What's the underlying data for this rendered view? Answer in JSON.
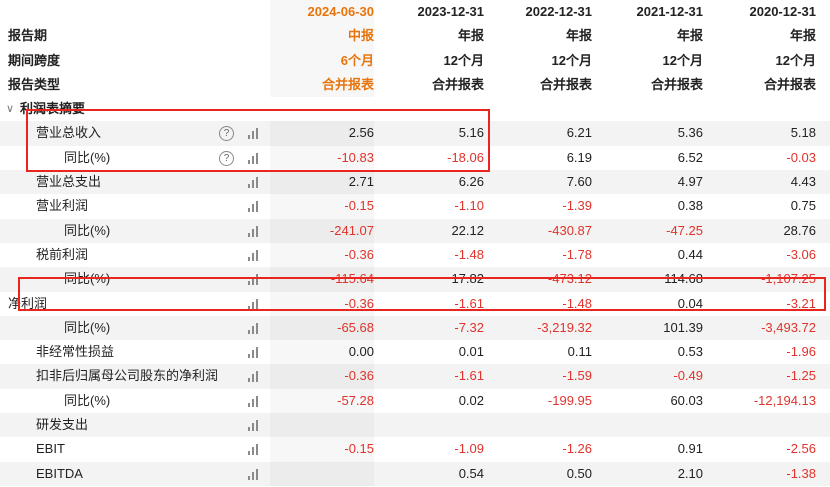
{
  "header": {
    "periods": [
      "2024-06-30",
      "2023-12-31",
      "2022-12-31",
      "2021-12-31",
      "2020-12-31"
    ],
    "report_period_label": "报告期",
    "report_period_values": [
      "中报",
      "年报",
      "年报",
      "年报",
      "年报"
    ],
    "span_label": "期间跨度",
    "span_values": [
      "6个月",
      "12个月",
      "12个月",
      "12个月",
      "12个月"
    ],
    "type_label": "报告类型",
    "type_values": [
      "合并报表",
      "合并报表",
      "合并报表",
      "合并报表",
      "合并报表"
    ]
  },
  "section": {
    "title": "利润表摘要",
    "chevron": "chevron-down-icon"
  },
  "rows": [
    {
      "label": "营业总收入",
      "level": 1,
      "help": true,
      "values": [
        "2.56",
        "5.16",
        "6.21",
        "5.36",
        "5.18"
      ]
    },
    {
      "label": "同比(%)",
      "level": 2,
      "help": true,
      "values": [
        "-10.83",
        "-18.06",
        "6.19",
        "6.52",
        "-0.03"
      ]
    },
    {
      "label": "营业总支出",
      "level": 1,
      "help": false,
      "values": [
        "2.71",
        "6.26",
        "7.60",
        "4.97",
        "4.43"
      ]
    },
    {
      "label": "营业利润",
      "level": 1,
      "help": false,
      "values": [
        "-0.15",
        "-1.10",
        "-1.39",
        "0.38",
        "0.75"
      ]
    },
    {
      "label": "同比(%)",
      "level": 2,
      "help": false,
      "values": [
        "-241.07",
        "22.12",
        "-430.87",
        "-47.25",
        "28.76"
      ]
    },
    {
      "label": "税前利润",
      "level": 1,
      "help": false,
      "values": [
        "-0.36",
        "-1.48",
        "-1.78",
        "0.44",
        "-3.06"
      ]
    },
    {
      "label": "同比(%)",
      "level": 2,
      "help": false,
      "values": [
        "-115.64",
        "17.82",
        "-473.12",
        "114.68",
        "-1,107.25"
      ]
    },
    {
      "label": "净利润",
      "level": 0,
      "help": false,
      "values": [
        "-0.36",
        "-1.61",
        "-1.48",
        "0.04",
        "-3.21"
      ]
    },
    {
      "label": "同比(%)",
      "level": 2,
      "help": false,
      "values": [
        "-65.68",
        "-7.32",
        "-3,219.32",
        "101.39",
        "-3,493.72"
      ]
    },
    {
      "label": "非经常性损益",
      "level": 1,
      "help": false,
      "values": [
        "0.00",
        "0.01",
        "0.11",
        "0.53",
        "-1.96"
      ]
    },
    {
      "label": "扣非后归属母公司股东的净利润",
      "level": 1,
      "help": false,
      "values": [
        "-0.36",
        "-1.61",
        "-1.59",
        "-0.49",
        "-1.25"
      ]
    },
    {
      "label": "同比(%)",
      "level": 2,
      "help": false,
      "values": [
        "-57.28",
        "0.02",
        "-199.95",
        "60.03",
        "-12,194.13"
      ]
    },
    {
      "label": "研发支出",
      "level": 1,
      "help": false,
      "values": [
        "",
        "",
        "",
        "",
        ""
      ]
    },
    {
      "label": "EBIT",
      "level": 1,
      "help": false,
      "values": [
        "-0.15",
        "-1.09",
        "-1.26",
        "0.91",
        "-2.56"
      ]
    },
    {
      "label": "EBITDA",
      "level": 1,
      "help": false,
      "values": [
        "",
        "0.54",
        "0.50",
        "2.10",
        "-1.38"
      ]
    }
  ],
  "icons": {
    "help": "question-circle-icon",
    "chart": "bar-chart-icon"
  },
  "colors": {
    "highlight_box": "#e8261e",
    "negative": "#e0332b",
    "current_period": "#e8740c"
  }
}
